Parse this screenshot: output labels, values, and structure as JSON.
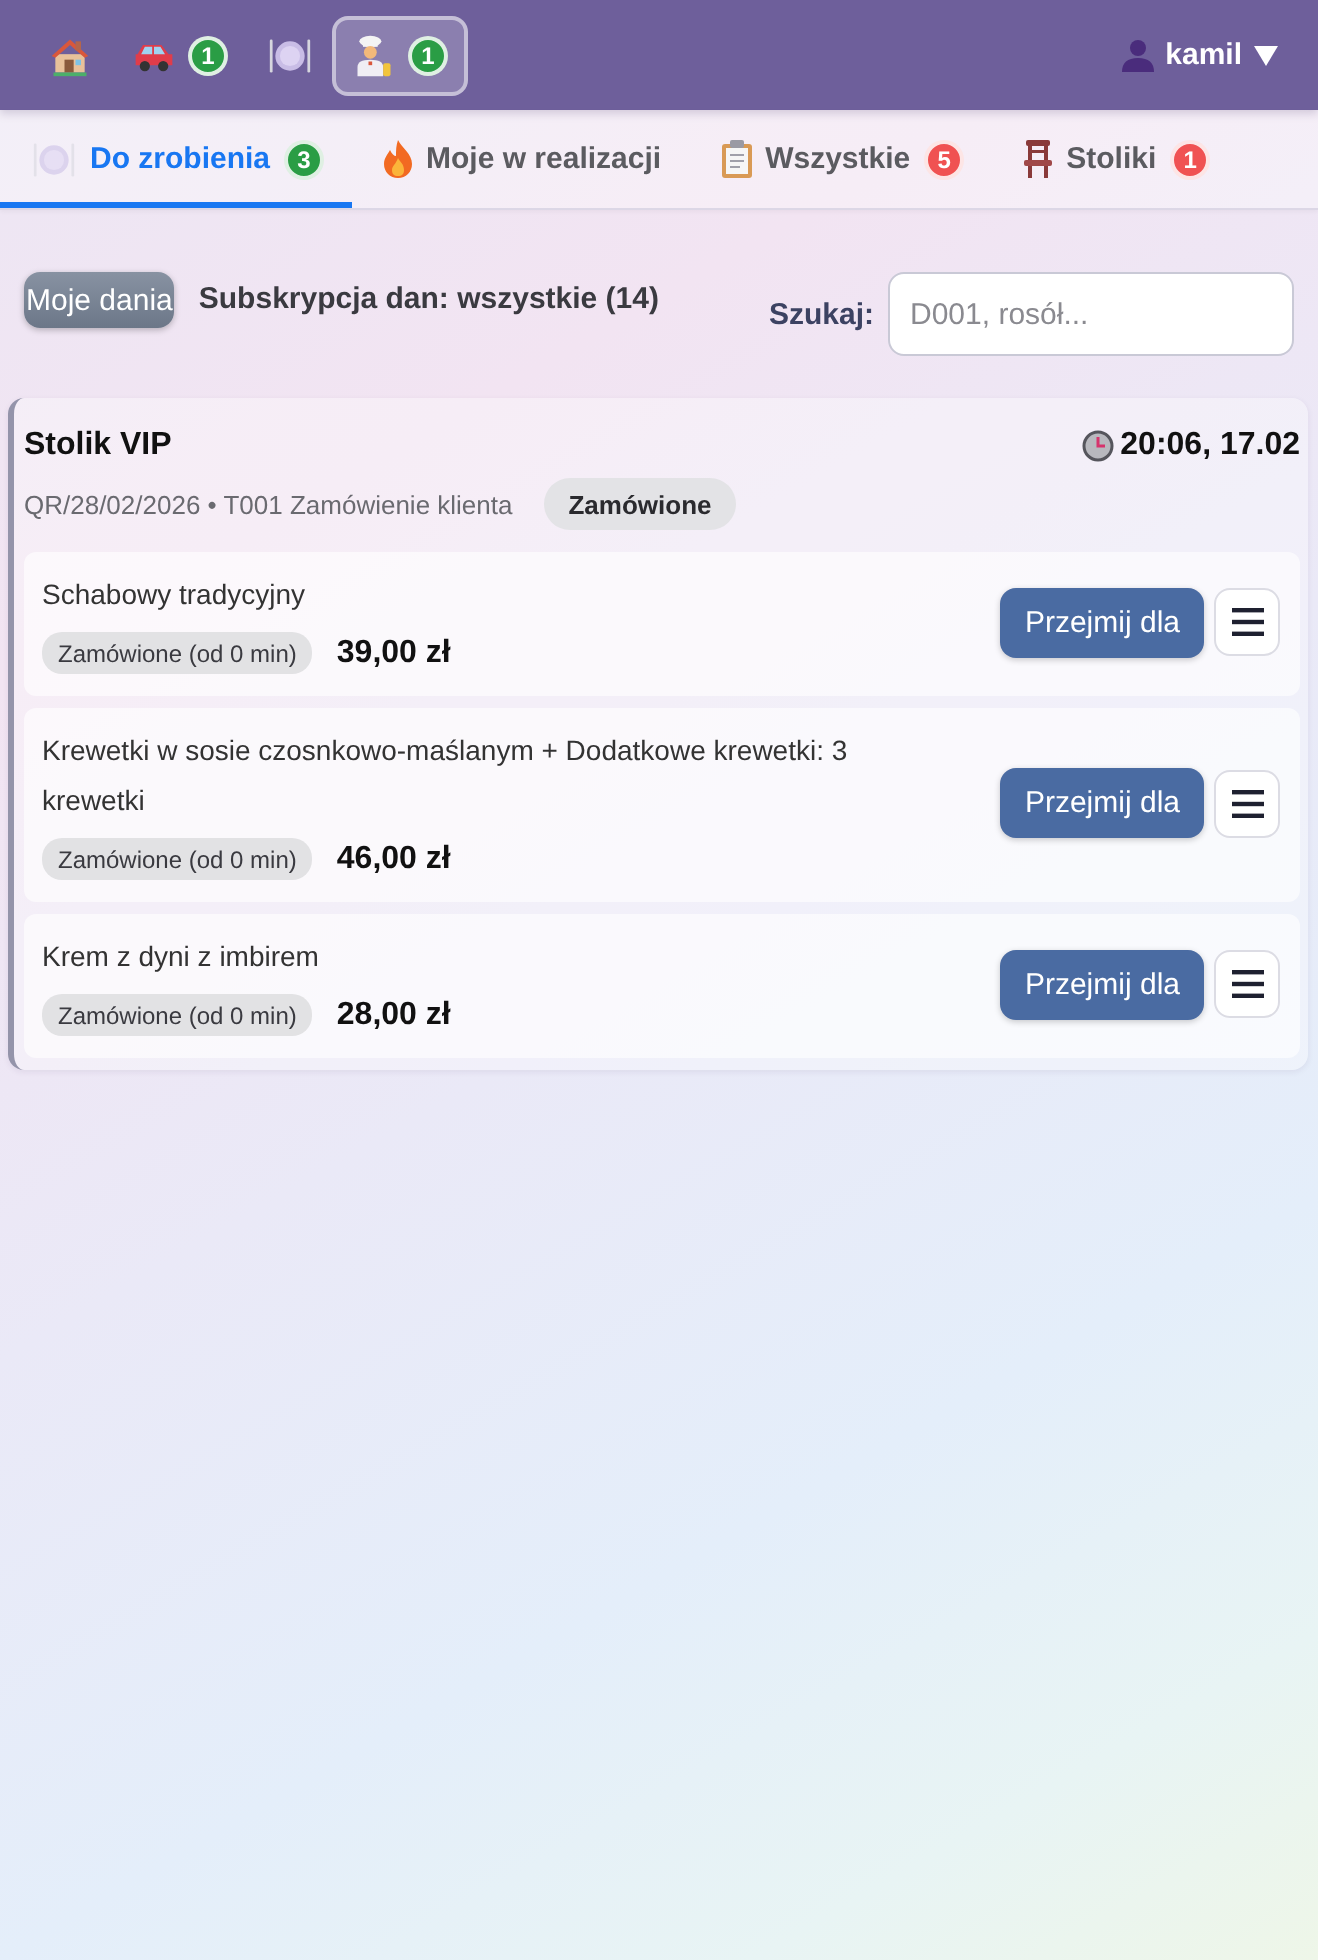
{
  "nav": {
    "items": [
      {
        "kind": "home",
        "selected": false
      },
      {
        "kind": "car",
        "badge": "1",
        "selected": false
      },
      {
        "kind": "plate",
        "selected": false
      },
      {
        "kind": "cook",
        "badge": "1",
        "selected": true
      }
    ],
    "user": {
      "name": "kamil"
    }
  },
  "tabs": [
    {
      "kind": "plate",
      "label": "Do zrobienia",
      "count": "3",
      "color": "#2a9d45",
      "selected": true
    },
    {
      "kind": "flame",
      "label": "Moje w realizacji",
      "selected": false
    },
    {
      "kind": "clipboard",
      "label": "Wszystkie",
      "count": "5",
      "color": "#f05252",
      "selected": false
    },
    {
      "kind": "chair",
      "label": "Stoliki",
      "count": "1",
      "color": "#f05252",
      "selected": false
    }
  ],
  "filters": {
    "my_dishes_button": "Moje dania",
    "subscription": "Subskrypcja dan: wszystkie (14)",
    "search": {
      "label": "Szukaj:",
      "placeholder": "D001, rosół..."
    }
  },
  "order": {
    "title": "Stolik VIP",
    "time": "20:06, 17.02",
    "meta": "QR/28/02/2026 • T001 Zamówienie klienta",
    "status": "Zamówione",
    "items": [
      {
        "name": "Schabowy tradycyjny",
        "status": "Zamówione (od 0 min)",
        "price": "39,00 zł",
        "action": "Przejmij dla"
      },
      {
        "name": "Krewetki w sosie czosnkowo-maślanym + Dodatkowe krewetki: 3 krewetki",
        "status": "Zamówione (od 0 min)",
        "price": "46,00 zł",
        "action": "Przejmij dla"
      },
      {
        "name": "Krem z dyni z imbirem",
        "status": "Zamówione (od 0 min)",
        "price": "28,00 zł",
        "action": "Przejmij dla"
      }
    ]
  }
}
